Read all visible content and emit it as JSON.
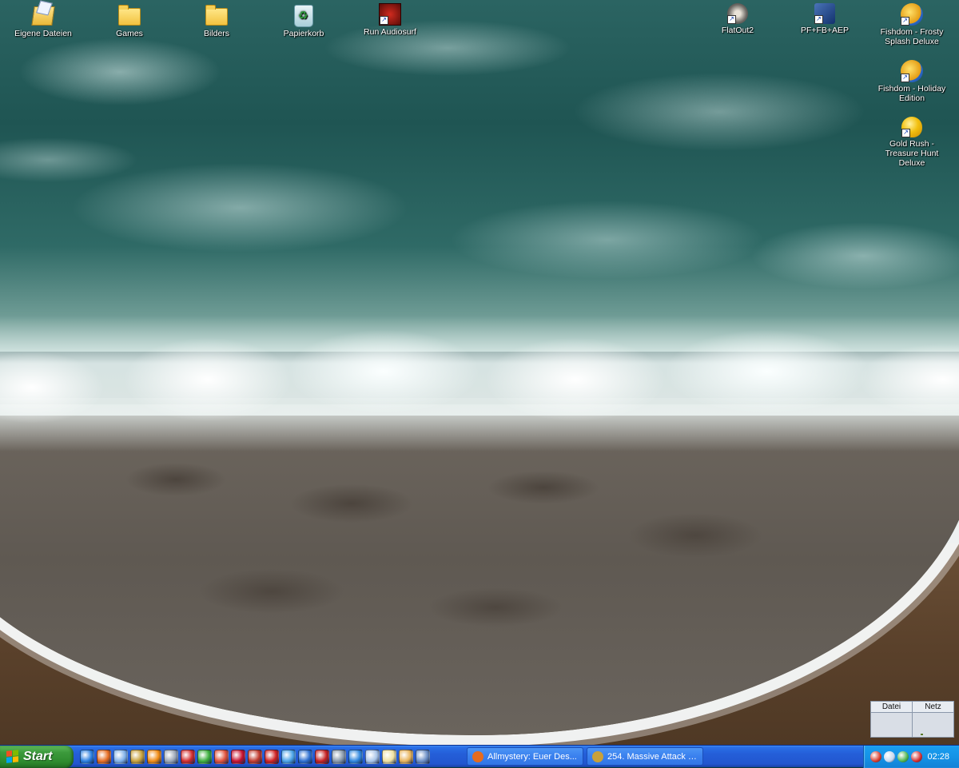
{
  "desktop": {
    "icons": [
      {
        "label": "Eigene Dateien",
        "icon": "my-documents-icon"
      },
      {
        "label": "Games",
        "icon": "folder-icon"
      },
      {
        "label": "Bilders",
        "icon": "folder-icon"
      },
      {
        "label": "Papierkorb",
        "icon": "recycle-bin-icon"
      },
      {
        "label": "Run Audiosurf",
        "icon": "audiosurf-icon"
      },
      {
        "label": "FlatOut2",
        "icon": "flatout2-icon"
      },
      {
        "label": "PF+FB+AEP",
        "icon": "game-shortcut-icon"
      },
      {
        "label": "Fishdom - Frosty Splash Deluxe",
        "icon": "fishdom-icon"
      },
      {
        "label": "Fishdom - Holiday Edition",
        "icon": "fishdom-icon"
      },
      {
        "label": "Gold Rush - Treasure Hunt Deluxe",
        "icon": "gold-rush-icon"
      }
    ]
  },
  "meter": {
    "col1": "Datei",
    "col2": "Netz"
  },
  "taskbar": {
    "start_label": "Start",
    "quicklaunch": [
      {
        "icon": "internet-explorer-icon",
        "color": "#2a7fe0"
      },
      {
        "icon": "firefox-icon",
        "color": "#e66b1f"
      },
      {
        "icon": "show-desktop-icon",
        "color": "#7fb0e8"
      },
      {
        "icon": "winamp-icon",
        "color": "#c9a13a"
      },
      {
        "icon": "vlc-icon",
        "color": "#f08a12"
      },
      {
        "icon": "settings-icon",
        "color": "#9aa5b5"
      },
      {
        "icon": "opera-icon",
        "color": "#d22a2a"
      },
      {
        "icon": "globe-icon",
        "color": "#3cae3c"
      },
      {
        "icon": "lifebuoy-icon",
        "color": "#e0503a"
      },
      {
        "icon": "flag-icon",
        "color": "#c8102e"
      },
      {
        "icon": "games-icon",
        "color": "#c0392b"
      },
      {
        "icon": "acrobat-icon",
        "color": "#cf1f1f"
      },
      {
        "icon": "messenger-icon",
        "color": "#4aa3e8"
      },
      {
        "icon": "network-icon",
        "color": "#2d6fd0"
      },
      {
        "icon": "ball-icon",
        "color": "#c51f1f"
      },
      {
        "icon": "tool-icon",
        "color": "#8898aa"
      },
      {
        "icon": "flash-icon",
        "color": "#2e86de"
      },
      {
        "icon": "arrow-icon",
        "color": "#a8c4e8"
      },
      {
        "icon": "notes-icon",
        "color": "#f0e0a0"
      },
      {
        "icon": "paint-icon",
        "color": "#e8b35a"
      },
      {
        "icon": "window-icon",
        "color": "#6c8fc6"
      }
    ],
    "tasks": [
      {
        "label": "Allmystery: Euer Des...",
        "icon": "firefox-icon",
        "color": "#e66b1f"
      },
      {
        "label": "254. Massive Attack -...",
        "icon": "winamp-icon",
        "color": "#c9a13a"
      }
    ],
    "tray": [
      {
        "icon": "tray-ball-icon",
        "color": "#d63a2a"
      },
      {
        "icon": "tray-search-icon",
        "color": "#c6d7ef"
      },
      {
        "icon": "tray-network-icon",
        "color": "#4bb34b"
      },
      {
        "icon": "tray-opera-icon",
        "color": "#d22a2a"
      }
    ],
    "clock": "02:28"
  }
}
